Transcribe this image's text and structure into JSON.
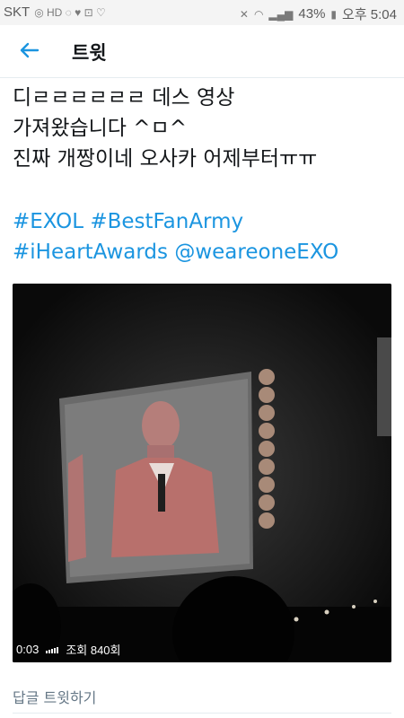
{
  "status_bar": {
    "carrier": "SKT",
    "battery": "43%",
    "time": "오후 5:04"
  },
  "header": {
    "title": "트윗"
  },
  "tweet": {
    "text_lines": [
      "디ㄹㄹㄹㄹㄹㄹ 데스 영상",
      "가져왔습니다 ^ㅁ^",
      "진짜 개짱이네 오사카 어제부터ㅠㅠ"
    ],
    "hashtag_lines": [
      [
        "#EXOL",
        "#BestFanArmy"
      ],
      [
        "#iHeartAwards",
        "@weareoneEXO"
      ]
    ]
  },
  "video": {
    "duration": "0:03",
    "views": "조회 840회"
  },
  "footer": {
    "reply_label": "답글 트윗하기"
  },
  "colors": {
    "link": "#1b95e0",
    "text": "#14171a",
    "muted": "#657786"
  },
  "icons": [
    "back-arrow-icon",
    "signal-bars-icon",
    "wifi-icon",
    "battery-icon",
    "mute-icon"
  ]
}
